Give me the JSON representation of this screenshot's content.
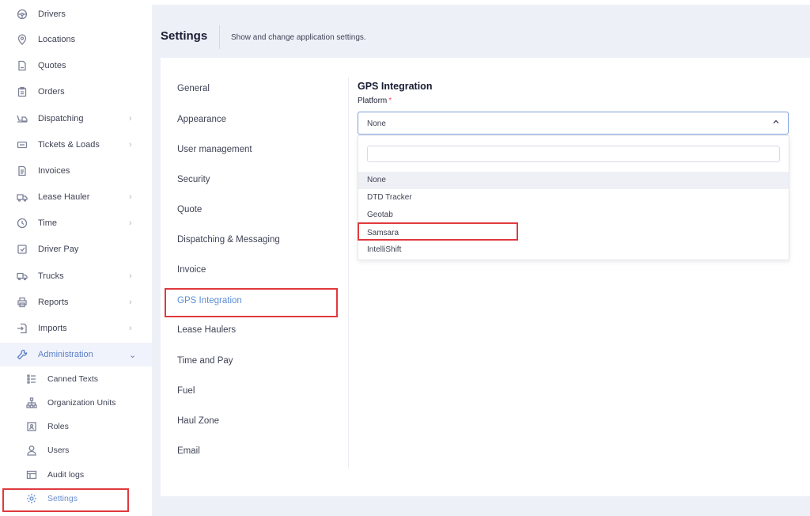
{
  "sidebar": {
    "items": [
      {
        "label": "Drivers",
        "icon": "steering-wheel-icon",
        "has_chevron": false
      },
      {
        "label": "Locations",
        "icon": "map-pin-icon",
        "has_chevron": false
      },
      {
        "label": "Quotes",
        "icon": "document-icon",
        "has_chevron": false
      },
      {
        "label": "Orders",
        "icon": "clipboard-icon",
        "has_chevron": false
      },
      {
        "label": "Dispatching",
        "icon": "dispatch-icon",
        "has_chevron": true
      },
      {
        "label": "Tickets & Loads",
        "icon": "ticket-icon",
        "has_chevron": true
      },
      {
        "label": "Invoices",
        "icon": "invoice-icon",
        "has_chevron": false
      },
      {
        "label": "Lease Hauler",
        "icon": "truck-icon",
        "has_chevron": true
      },
      {
        "label": "Time",
        "icon": "clock-icon",
        "has_chevron": true
      },
      {
        "label": "Driver Pay",
        "icon": "pay-icon",
        "has_chevron": false
      },
      {
        "label": "Trucks",
        "icon": "trucks-icon",
        "has_chevron": true
      },
      {
        "label": "Reports",
        "icon": "printer-icon",
        "has_chevron": true
      },
      {
        "label": "Imports",
        "icon": "import-icon",
        "has_chevron": true
      },
      {
        "label": "Administration",
        "icon": "wrench-icon",
        "has_chevron": true
      }
    ],
    "sub_items": [
      {
        "label": "Canned Texts",
        "icon": "list-icon"
      },
      {
        "label": "Organization Units",
        "icon": "org-chart-icon"
      },
      {
        "label": "Roles",
        "icon": "id-badge-icon"
      },
      {
        "label": "Users",
        "icon": "user-icon"
      },
      {
        "label": "Audit logs",
        "icon": "table-icon"
      },
      {
        "label": "Settings",
        "icon": "gear-icon"
      }
    ]
  },
  "header": {
    "title": "Settings",
    "subtitle": "Show and change application settings."
  },
  "settings_tabs": [
    "General",
    "Appearance",
    "User management",
    "Security",
    "Quote",
    "Dispatching & Messaging",
    "Invoice",
    "GPS Integration",
    "Lease Haulers",
    "Time and Pay",
    "Fuel",
    "Haul Zone",
    "Email"
  ],
  "active_tab": "GPS Integration",
  "gps": {
    "title": "GPS Integration",
    "platform_label": "Platform",
    "required_mark": "*",
    "selected_value": "None",
    "search_placeholder": "",
    "options": [
      "None",
      "DTD Tracker",
      "Geotab",
      "Samsara",
      "IntelliShift"
    ]
  },
  "colors": {
    "accent": "#5b8fd6",
    "annotation_red": "#e0393e",
    "required": "#f64e60"
  }
}
